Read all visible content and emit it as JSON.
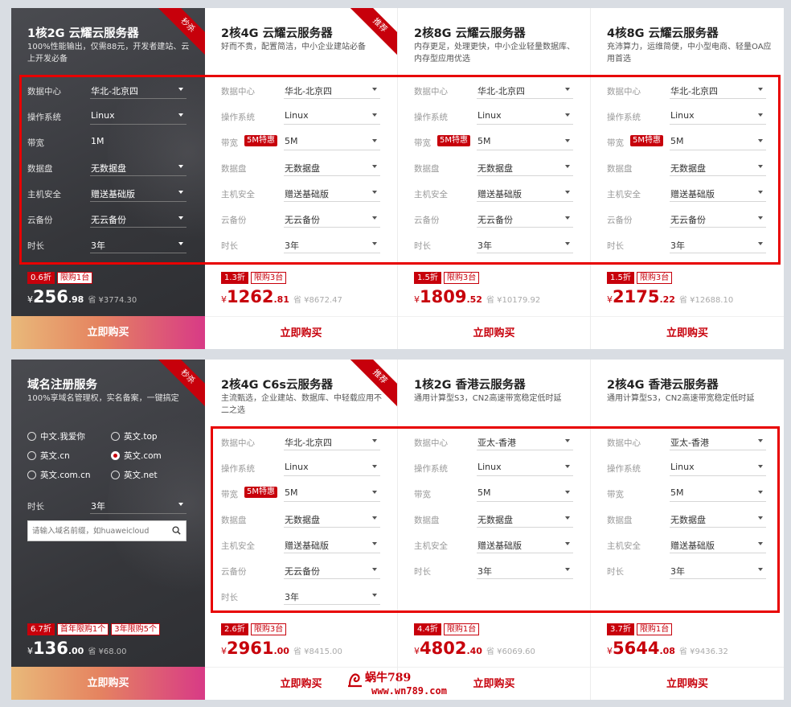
{
  "top": {
    "dark": {
      "title": "1核2G 云耀云服务器",
      "desc": "100%性能输出，仅需88元，开发者建站、云上开发必备",
      "ribbon": "秒杀",
      "rows": [
        {
          "label": "数据中心",
          "value": "华北-北京四"
        },
        {
          "label": "操作系统",
          "value": "Linux"
        },
        {
          "label": "带宽",
          "value": "1M"
        },
        {
          "label": "数据盘",
          "value": "无数据盘"
        },
        {
          "label": "主机安全",
          "value": "赠送基础版"
        },
        {
          "label": "云备份",
          "value": "无云备份"
        },
        {
          "label": "时长",
          "value": "3年"
        }
      ],
      "discount": "0.6折",
      "limit": "限购1台",
      "currency": "¥",
      "price_int": "256",
      "price_dec": ".98",
      "orig": "省 ¥3774.30",
      "buy": "立即购买"
    },
    "cards": [
      {
        "title": "2核4G 云耀云服务器",
        "desc": "好而不贵，配置简洁，中小企业建站必备",
        "ribbon": "推荐",
        "rows": [
          {
            "label": "数据中心",
            "value": "华北-北京四"
          },
          {
            "label": "操作系统",
            "value": "Linux"
          },
          {
            "label": "带宽",
            "value": "5M",
            "badge": "5M特惠"
          },
          {
            "label": "数据盘",
            "value": "无数据盘"
          },
          {
            "label": "主机安全",
            "value": "赠送基础版"
          },
          {
            "label": "云备份",
            "value": "无云备份"
          },
          {
            "label": "时长",
            "value": "3年"
          }
        ],
        "discount": "1.3折",
        "limit": "限购3台",
        "currency": "¥",
        "price_int": "1262",
        "price_dec": ".81",
        "orig": "省 ¥8672.47",
        "buy": "立即购买"
      },
      {
        "title": "2核8G 云耀云服务器",
        "desc": "内存更足，处理更快，中小企业轻量数据库、内存型应用优选",
        "rows": [
          {
            "label": "数据中心",
            "value": "华北-北京四"
          },
          {
            "label": "操作系统",
            "value": "Linux"
          },
          {
            "label": "带宽",
            "value": "5M",
            "badge": "5M特惠"
          },
          {
            "label": "数据盘",
            "value": "无数据盘"
          },
          {
            "label": "主机安全",
            "value": "赠送基础版"
          },
          {
            "label": "云备份",
            "value": "无云备份"
          },
          {
            "label": "时长",
            "value": "3年"
          }
        ],
        "discount": "1.5折",
        "limit": "限购3台",
        "currency": "¥",
        "price_int": "1809",
        "price_dec": ".52",
        "orig": "省 ¥10179.92",
        "buy": "立即购买"
      },
      {
        "title": "4核8G 云耀云服务器",
        "desc": "充沛算力，运维简便，中小型电商、轻量OA应用首选",
        "rows": [
          {
            "label": "数据中心",
            "value": "华北-北京四"
          },
          {
            "label": "操作系统",
            "value": "Linux"
          },
          {
            "label": "带宽",
            "value": "5M",
            "badge": "5M特惠"
          },
          {
            "label": "数据盘",
            "value": "无数据盘"
          },
          {
            "label": "主机安全",
            "value": "赠送基础版"
          },
          {
            "label": "云备份",
            "value": "无云备份"
          },
          {
            "label": "时长",
            "value": "3年"
          }
        ],
        "discount": "1.5折",
        "limit": "限购3台",
        "currency": "¥",
        "price_int": "2175",
        "price_dec": ".22",
        "orig": "省 ¥12688.10",
        "buy": "立即购买"
      }
    ]
  },
  "bottom": {
    "domain": {
      "title": "域名注册服务",
      "desc": "100%享域名管理权，实名备案，一键搞定",
      "ribbon": "秒杀",
      "options": [
        {
          "label": "中文.我爱你",
          "checked": false
        },
        {
          "label": "英文.top",
          "checked": false
        },
        {
          "label": "英文.cn",
          "checked": false
        },
        {
          "label": "英文.com",
          "checked": true
        },
        {
          "label": "英文.com.cn",
          "checked": false
        },
        {
          "label": "英文.net",
          "checked": false
        }
      ],
      "duration_label": "时长",
      "duration_value": "3年",
      "search_placeholder": "请输入域名前缀，如huaweicloud",
      "discount": "6.7折",
      "limit1": "首年限购1个",
      "limit2": "3年限购5个",
      "currency": "¥",
      "price_int": "136",
      "price_dec": ".00",
      "orig": "省 ¥68.00",
      "buy": "立即购买"
    },
    "cards": [
      {
        "title": "2核4G C6s云服务器",
        "desc": "主流甄选，企业建站、数据库、中轻载应用不二之选",
        "ribbon": "推荐",
        "rows": [
          {
            "label": "数据中心",
            "value": "华北-北京四"
          },
          {
            "label": "操作系统",
            "value": "Linux"
          },
          {
            "label": "带宽",
            "value": "5M",
            "badge": "5M特惠"
          },
          {
            "label": "数据盘",
            "value": "无数据盘"
          },
          {
            "label": "主机安全",
            "value": "赠送基础版"
          },
          {
            "label": "云备份",
            "value": "无云备份"
          },
          {
            "label": "时长",
            "value": "3年"
          }
        ],
        "discount": "2.6折",
        "limit": "限购3台",
        "currency": "¥",
        "price_int": "2961",
        "price_dec": ".00",
        "orig": "省 ¥8415.00",
        "buy": "立即购买"
      },
      {
        "title": "1核2G 香港云服务器",
        "desc": "通用计算型S3，CN2高速带宽稳定低时延",
        "rows": [
          {
            "label": "数据中心",
            "value": "亚太-香港"
          },
          {
            "label": "操作系统",
            "value": "Linux"
          },
          {
            "label": "带宽",
            "value": "5M"
          },
          {
            "label": "数据盘",
            "value": "无数据盘"
          },
          {
            "label": "主机安全",
            "value": "赠送基础版"
          },
          {
            "label": "时长",
            "value": "3年"
          }
        ],
        "discount": "4.4折",
        "limit": "限购1台",
        "currency": "¥",
        "price_int": "4802",
        "price_dec": ".40",
        "orig": "省 ¥6069.60",
        "buy": "立即购买"
      },
      {
        "title": "2核4G 香港云服务器",
        "desc": "通用计算型S3，CN2高速带宽稳定低时延",
        "rows": [
          {
            "label": "数据中心",
            "value": "亚太-香港"
          },
          {
            "label": "操作系统",
            "value": "Linux"
          },
          {
            "label": "带宽",
            "value": "5M"
          },
          {
            "label": "数据盘",
            "value": "无数据盘"
          },
          {
            "label": "主机安全",
            "value": "赠送基础版"
          },
          {
            "label": "时长",
            "value": "3年"
          }
        ],
        "discount": "3.7折",
        "limit": "限购1台",
        "currency": "¥",
        "price_int": "5644",
        "price_dec": ".08",
        "orig": "省 ¥9436.32",
        "buy": "立即购买"
      }
    ]
  },
  "watermark": {
    "text": "蜗牛789",
    "url": "www.wn789.com"
  },
  "colors": {
    "brand_red": "#c7000b",
    "highlight_box": "#e80000"
  }
}
